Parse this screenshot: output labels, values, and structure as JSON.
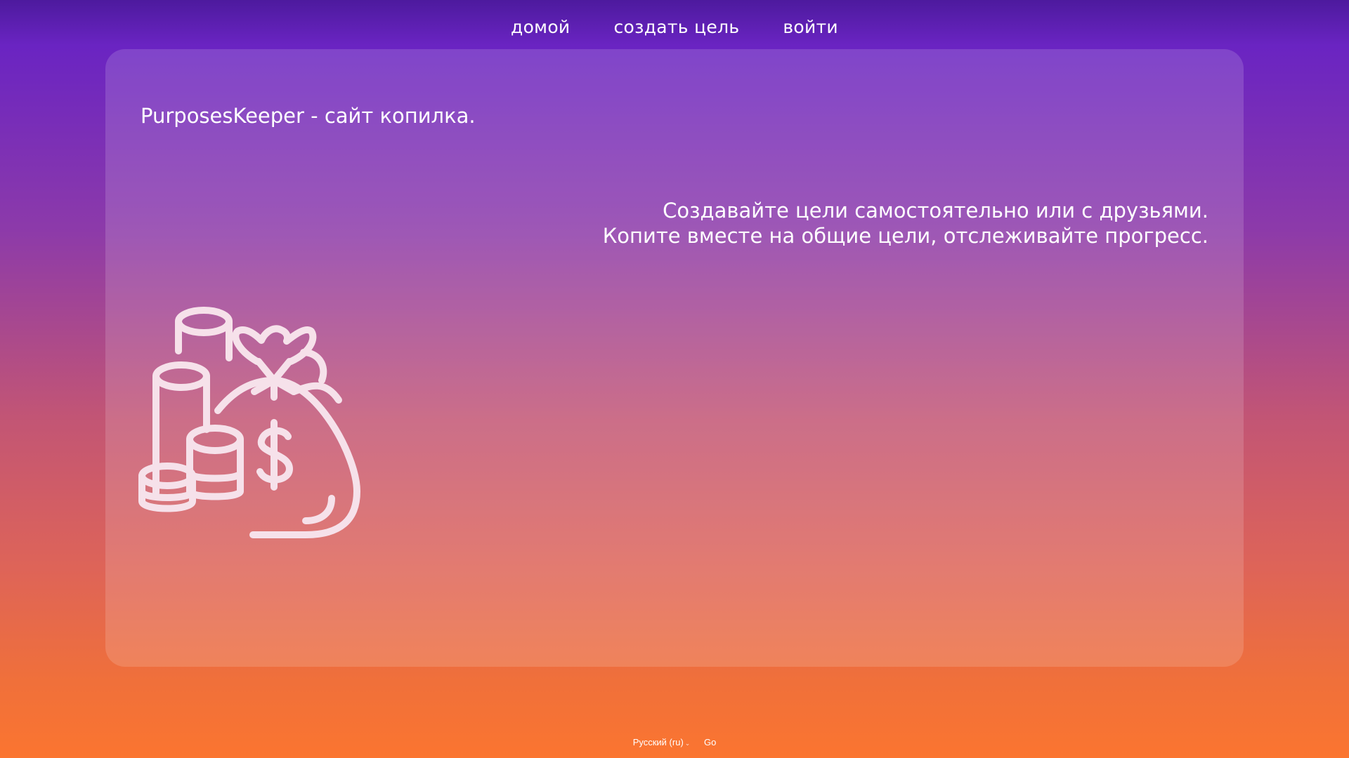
{
  "nav": {
    "items": [
      {
        "label": "домой"
      },
      {
        "label": "создать цель"
      },
      {
        "label": "войти"
      }
    ]
  },
  "card": {
    "title": "PurposesKeeper - сайт копилка.",
    "tagline_line1": "Создавайте цели самостоятельно или с друзьями.",
    "tagline_line2": "Копите вместе на общие цели, отслеживайте прогресс.",
    "illustration_icon": "money-bag-coins-icon"
  },
  "footer": {
    "language": "Русский (ru)",
    "go_label": "Go"
  },
  "colors": {
    "gradient_top": "#4d1a9e",
    "gradient_bottom": "#fb7530",
    "illustration_stroke": "#f6e1ea"
  }
}
